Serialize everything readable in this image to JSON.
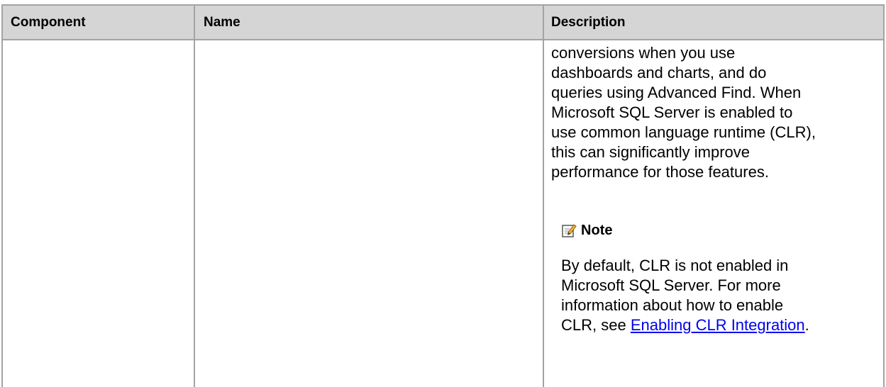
{
  "table": {
    "headers": [
      "Component",
      "Name",
      "Description"
    ]
  },
  "description_lines": [
    "conversions when you use",
    "dashboards and charts, and do",
    "queries using Advanced Find. When",
    "Microsoft SQL Server is enabled to",
    "use common language runtime (CLR),",
    "this can significantly improve",
    "performance for those features."
  ],
  "note": {
    "icon": "note-pencil-icon",
    "heading": "Note",
    "lines": [
      "By default, CLR is not enabled in",
      "Microsoft SQL Server. For more",
      "information about how to enable"
    ],
    "last_line_prefix": "CLR, see ",
    "link_text": "Enabling CLR Integration",
    "last_line_suffix": "."
  },
  "colors": {
    "header_bg": "#d5d5d5",
    "border": "#a3a3a3",
    "link": "#0000ee"
  }
}
